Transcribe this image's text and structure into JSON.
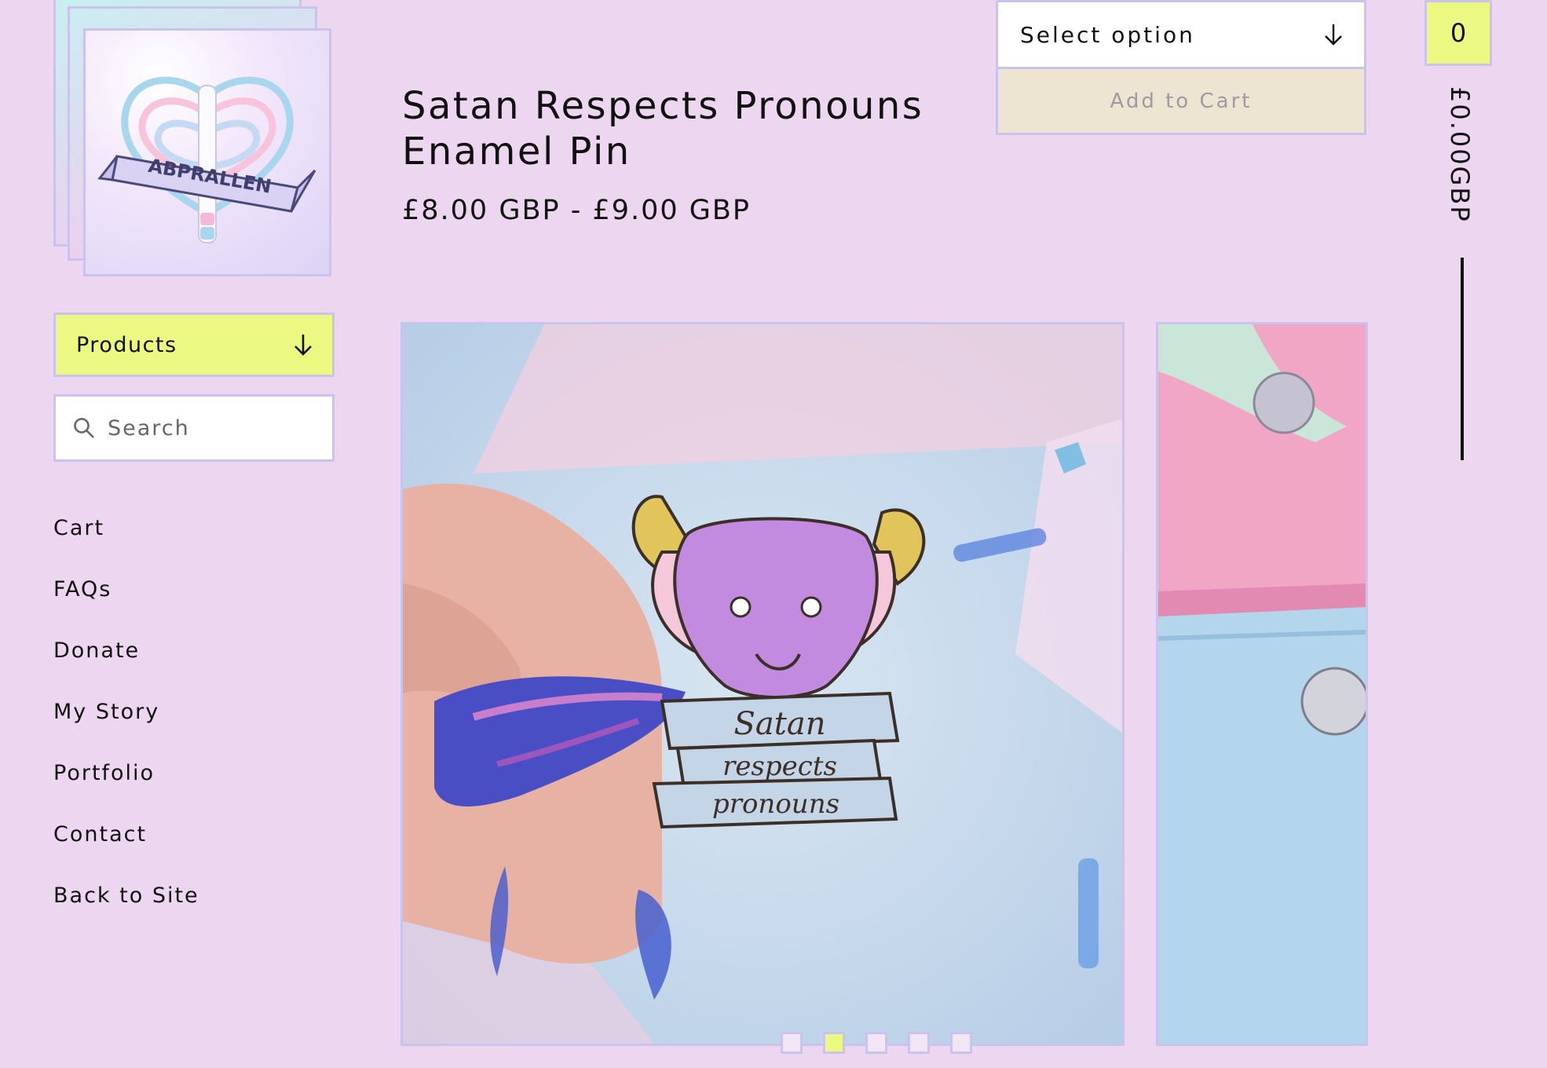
{
  "logo": {
    "text": "ABPRALLEN"
  },
  "nav": {
    "products_label": "Products",
    "search_placeholder": "Search",
    "links": [
      "Cart",
      "FAQs",
      "Donate",
      "My Story",
      "Portfolio",
      "Contact",
      "Back to Site"
    ]
  },
  "product": {
    "title": "Satan Respects Pronouns Enamel Pin",
    "price": "£8.00 GBP - £9.00 GBP",
    "select_label": "Select option",
    "add_to_cart_label": "Add to Cart",
    "pin_text": [
      "Satan",
      "respects",
      "pronouns"
    ]
  },
  "cart": {
    "count": "0",
    "total": "£0.00GBP"
  },
  "gallery": {
    "image_count": 5,
    "active_index": 1
  },
  "colors": {
    "background": "#edd6ef",
    "accent": "#ebf983",
    "border": "#c9c3ee"
  }
}
